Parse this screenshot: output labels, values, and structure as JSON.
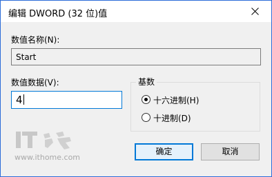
{
  "window": {
    "title": "编辑 DWORD (32 位)值"
  },
  "value_name": {
    "label": "数值名称(N):",
    "value": "Start"
  },
  "value_data": {
    "label": "数值数据(V):",
    "value": "4"
  },
  "base": {
    "title": "基数",
    "options": [
      {
        "label": "十六进制(H)",
        "selected": true
      },
      {
        "label": "十进制(D)",
        "selected": false
      }
    ]
  },
  "buttons": {
    "ok": "确定",
    "cancel": "取消"
  },
  "watermark": {
    "logo": "IT之家",
    "url": "www.ithome.com"
  },
  "colors": {
    "accent": "#0078d7",
    "window_border": "#2b6cd8",
    "dialog_bg": "#f0f0f0"
  }
}
